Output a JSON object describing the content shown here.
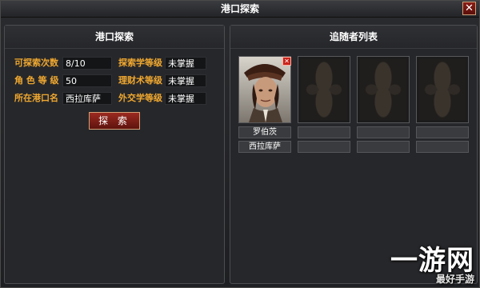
{
  "window": {
    "title": "港口探索",
    "close_glyph": "✕"
  },
  "explore_panel": {
    "header": "港口探索",
    "fields": [
      {
        "label": "可探索次数",
        "value": "8/10"
      },
      {
        "label": "角 色 等 级",
        "value": "50"
      },
      {
        "label": "所在港口名",
        "value": "西拉库萨"
      },
      {
        "label": "探索学等级",
        "value": "未掌握"
      },
      {
        "label": "理财术等级",
        "value": "未掌握"
      },
      {
        "label": "外交学等级",
        "value": "未掌握"
      }
    ],
    "explore_button": "探 索"
  },
  "followers_panel": {
    "header": "追随者列表",
    "followers": [
      {
        "name": "罗伯茨",
        "port": "西拉库萨",
        "portrait": "pirate-captain-portrait-icon"
      },
      {
        "name": "",
        "port": ""
      },
      {
        "name": "",
        "port": ""
      },
      {
        "name": "",
        "port": ""
      }
    ]
  },
  "watermark": {
    "main": "一游网",
    "sub": "最好手游"
  },
  "colors": {
    "label": "#f0a830",
    "value": "#ffffff",
    "button": "#9b2a20",
    "background": "#26272a"
  }
}
